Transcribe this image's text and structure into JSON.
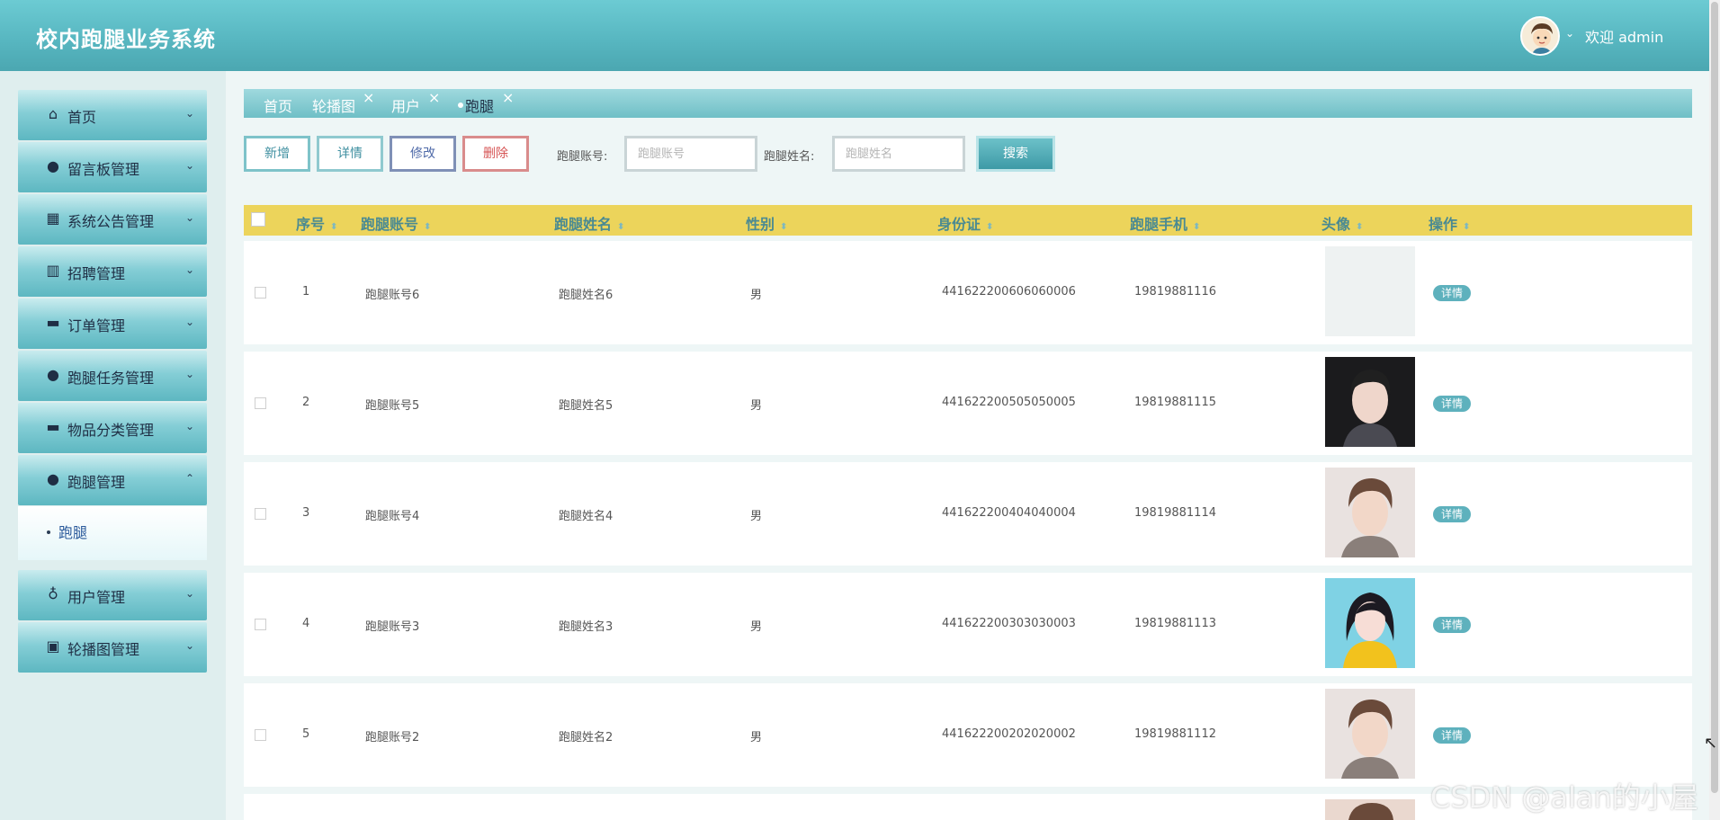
{
  "app": {
    "title": "校内跑腿业务系统",
    "welcome": "欢迎 admin"
  },
  "sidebar": {
    "items": [
      {
        "label": "首页",
        "icon": "home-icon"
      },
      {
        "label": "留言板管理",
        "icon": "message-icon"
      },
      {
        "label": "系统公告管理",
        "icon": "grid-icon"
      },
      {
        "label": "招聘管理",
        "icon": "building-icon"
      },
      {
        "label": "订单管理",
        "icon": "card-icon"
      },
      {
        "label": "跑腿任务管理",
        "icon": "drop-icon"
      },
      {
        "label": "物品分类管理",
        "icon": "card-icon"
      },
      {
        "label": "跑腿管理",
        "icon": "user-icon"
      },
      {
        "label": "用户管理",
        "icon": "badge-icon"
      },
      {
        "label": "轮播图管理",
        "icon": "image-icon"
      }
    ],
    "submenu": {
      "label": "跑腿"
    }
  },
  "tabs": [
    {
      "label": "首页"
    },
    {
      "label": "轮播图"
    },
    {
      "label": "用户"
    },
    {
      "label": "跑腿"
    }
  ],
  "toolbar": {
    "add": "新增",
    "detail": "详情",
    "edit": "修改",
    "delete": "删除",
    "account_label": "跑腿账号:",
    "account_placeholder": "跑腿账号",
    "name_label": "跑腿姓名:",
    "name_placeholder": "跑腿姓名",
    "search": "搜索"
  },
  "table": {
    "columns": [
      "序号",
      "跑腿账号",
      "跑腿姓名",
      "性别",
      "身份证",
      "跑腿手机",
      "头像",
      "操作"
    ],
    "action_label": "详情",
    "rows": [
      {
        "index": "1",
        "account": "跑腿账号6",
        "name": "跑腿姓名6",
        "gender": "男",
        "id_card": "441622200606060006",
        "phone": "19819881116"
      },
      {
        "index": "2",
        "account": "跑腿账号5",
        "name": "跑腿姓名5",
        "gender": "男",
        "id_card": "441622200505050005",
        "phone": "19819881115"
      },
      {
        "index": "3",
        "account": "跑腿账号4",
        "name": "跑腿姓名4",
        "gender": "男",
        "id_card": "441622200404040004",
        "phone": "19819881114"
      },
      {
        "index": "4",
        "account": "跑腿账号3",
        "name": "跑腿姓名3",
        "gender": "男",
        "id_card": "441622200303030003",
        "phone": "19819881113"
      },
      {
        "index": "5",
        "account": "跑腿账号2",
        "name": "跑腿姓名2",
        "gender": "男",
        "id_card": "441622200202020002",
        "phone": "19819881112"
      }
    ]
  },
  "watermark": "CSDN @alan的小屋",
  "colors": {
    "header": "#58b7c1",
    "table_head": "#ecd45b",
    "accent": "#5eb1bd",
    "danger": "#d65454"
  }
}
